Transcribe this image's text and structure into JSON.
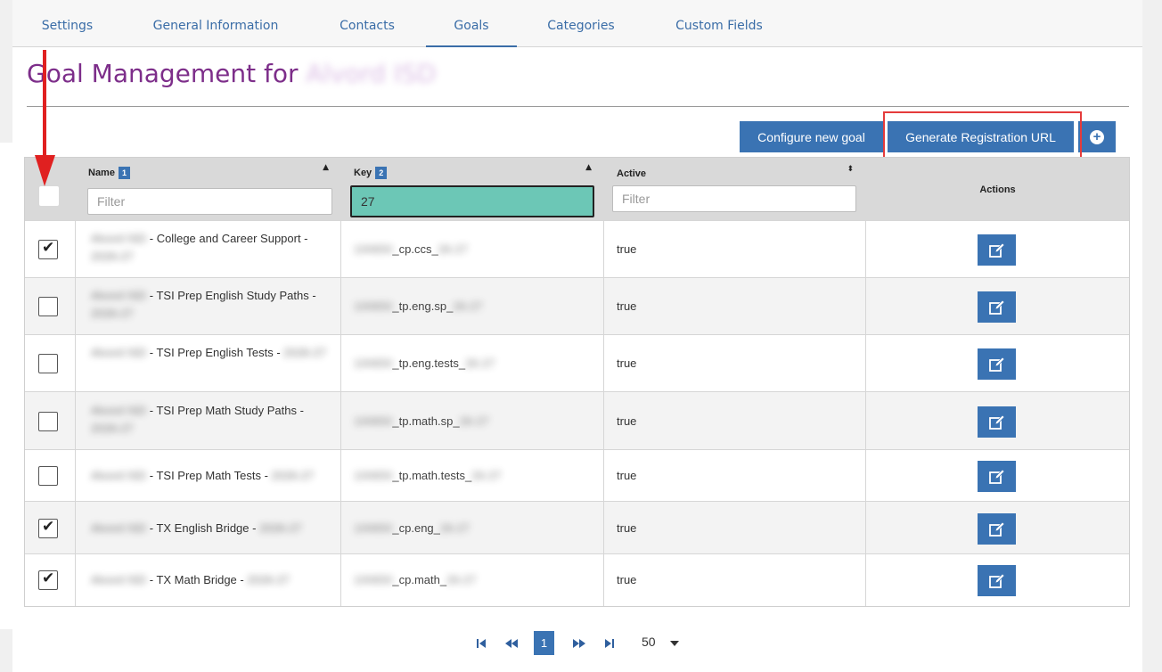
{
  "tabs": [
    {
      "label": "Settings",
      "active": false
    },
    {
      "label": "General Information",
      "active": false
    },
    {
      "label": "Contacts",
      "active": false
    },
    {
      "label": "Goals",
      "active": true
    },
    {
      "label": "Categories",
      "active": false
    },
    {
      "label": "Custom Fields",
      "active": false
    }
  ],
  "page": {
    "title": "Goal Management for",
    "title_org_redacted": "Alvord ISD"
  },
  "toolbar": {
    "configure_label": "Configure new goal",
    "generate_label": "Generate Registration URL",
    "add_icon": "plus-circle-icon"
  },
  "table": {
    "columns": {
      "name": {
        "label": "Name",
        "sort_order": "1",
        "filter_placeholder": "Filter",
        "filter_value": ""
      },
      "key": {
        "label": "Key",
        "sort_order": "2",
        "filter_placeholder": "Filter",
        "filter_value": "27"
      },
      "active": {
        "label": "Active",
        "filter_placeholder": "Filter",
        "filter_value": ""
      },
      "actions": {
        "label": "Actions"
      }
    },
    "rows": [
      {
        "checked": true,
        "name_pre": "Alvord ISD",
        "name": " - College and Career Support - ",
        "name_post": "2026-27",
        "key_pre": "100650",
        "key": "_cp.ccs_",
        "key_post": "26-27",
        "active": "true"
      },
      {
        "checked": false,
        "name_pre": "Alvord ISD",
        "name": " - TSI Prep English Study Paths - ",
        "name_post": "2026-27",
        "key_pre": "100650",
        "key": "_tp.eng.sp_",
        "key_post": "26-27",
        "active": "true"
      },
      {
        "checked": false,
        "name_pre": "Alvord ISD",
        "name": " - TSI Prep English Tests - ",
        "name_post": "2026-27",
        "key_pre": "100650",
        "key": "_tp.eng.tests_",
        "key_post": "26-27",
        "active": "true"
      },
      {
        "checked": false,
        "name_pre": "Alvord ISD",
        "name": " - TSI Prep Math Study Paths - ",
        "name_post": "2026-27",
        "key_pre": "100650",
        "key": "_tp.math.sp_",
        "key_post": "26-27",
        "active": "true"
      },
      {
        "checked": false,
        "name_pre": "Alvord ISD",
        "name": " - TSI Prep Math Tests - ",
        "name_post": "2026-27",
        "key_pre": "100650",
        "key": "_tp.math.tests_",
        "key_post": "26-27",
        "active": "true"
      },
      {
        "checked": true,
        "name_pre": "Alvord ISD",
        "name": " - TX English Bridge - ",
        "name_post": "2026-27",
        "key_pre": "100650",
        "key": "_cp.eng_",
        "key_post": "26-27",
        "active": "true"
      },
      {
        "checked": true,
        "name_pre": "Alvord ISD",
        "name": " - TX Math Bridge - ",
        "name_post": "2026-27",
        "key_pre": "100650",
        "key": "_cp.math_",
        "key_post": "26-27",
        "active": "true"
      }
    ]
  },
  "pagination": {
    "current_page": "1",
    "page_size": "50",
    "first_icon": "first-page-icon",
    "prev_icon": "previous-page-icon",
    "next_icon": "next-page-icon",
    "last_icon": "last-page-icon"
  },
  "annotations": {
    "arrow_color": "#e02020",
    "highlight_color": "#e53b3b"
  },
  "colors": {
    "brand_blue": "#3a73b3",
    "title_purple": "#7d2e8a",
    "active_filter": "#6cc7b6"
  }
}
